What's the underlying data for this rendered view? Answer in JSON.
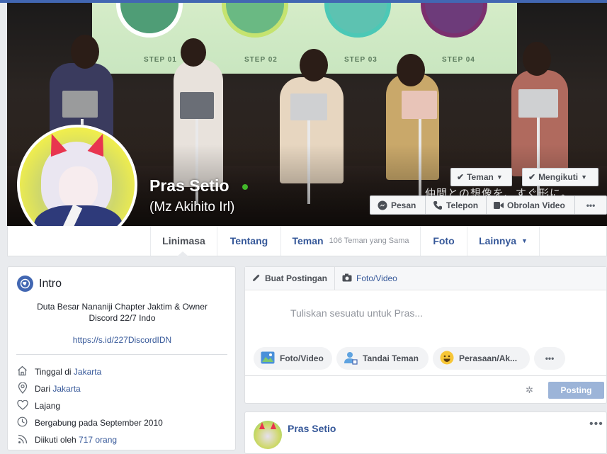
{
  "profile": {
    "name": "Pras Setio",
    "alternate_name": "(Mz Akihito Irl)",
    "online": true,
    "cover_text": "仲間との想像を、すぐ形に。",
    "cover_steps": [
      "STEP 01",
      "STEP 02",
      "STEP 03",
      "STEP 04"
    ],
    "cover_step_numbers": [
      "01",
      "02",
      "03",
      "04"
    ]
  },
  "actions": {
    "friends_label": "Teman",
    "following_label": "Mengikuti",
    "message_label": "Pesan",
    "call_label": "Telepon",
    "video_chat_label": "Obrolan Video",
    "more_label": "•••"
  },
  "tabs": [
    {
      "label": "Linimasa",
      "active": true
    },
    {
      "label": "Tentang"
    },
    {
      "label": "Teman",
      "sub": "106 Teman yang Sama"
    },
    {
      "label": "Foto"
    },
    {
      "label": "Lainnya",
      "caret": true
    }
  ],
  "intro": {
    "title": "Intro",
    "bio": "Duta Besar Nananiji Chapter Jaktim & Owner Discord 22/7 Indo",
    "link": "https://s.id/227DiscordIDN",
    "rows": [
      {
        "icon": "house-icon",
        "prefix": "Tinggal di ",
        "link": "Jakarta"
      },
      {
        "icon": "location-pin-icon",
        "prefix": "Dari ",
        "link": "Jakarta"
      },
      {
        "icon": "heart-icon",
        "prefix": "Lajang",
        "link": ""
      },
      {
        "icon": "clock-icon",
        "prefix": "Bergabung pada September 2010",
        "link": ""
      },
      {
        "icon": "rss-icon",
        "prefix": "Diikuti oleh ",
        "link": "717 orang"
      }
    ]
  },
  "composer": {
    "create_post": "Buat Postingan",
    "photo_video_tab": "Foto/Video",
    "placeholder": "Tuliskan sesuatu untuk Pras...",
    "pills": [
      "Foto/Video",
      "Tandai Teman",
      "Perasaan/Ak...",
      "•••"
    ],
    "post_button": "Posting"
  },
  "feed": {
    "post_author": "Pras Setio",
    "more": "•••"
  },
  "colors": {
    "brand_blue": "#4267b2",
    "link_blue": "#365899",
    "online_green": "#42b72a",
    "disabled_post": "#9cb4d8"
  }
}
